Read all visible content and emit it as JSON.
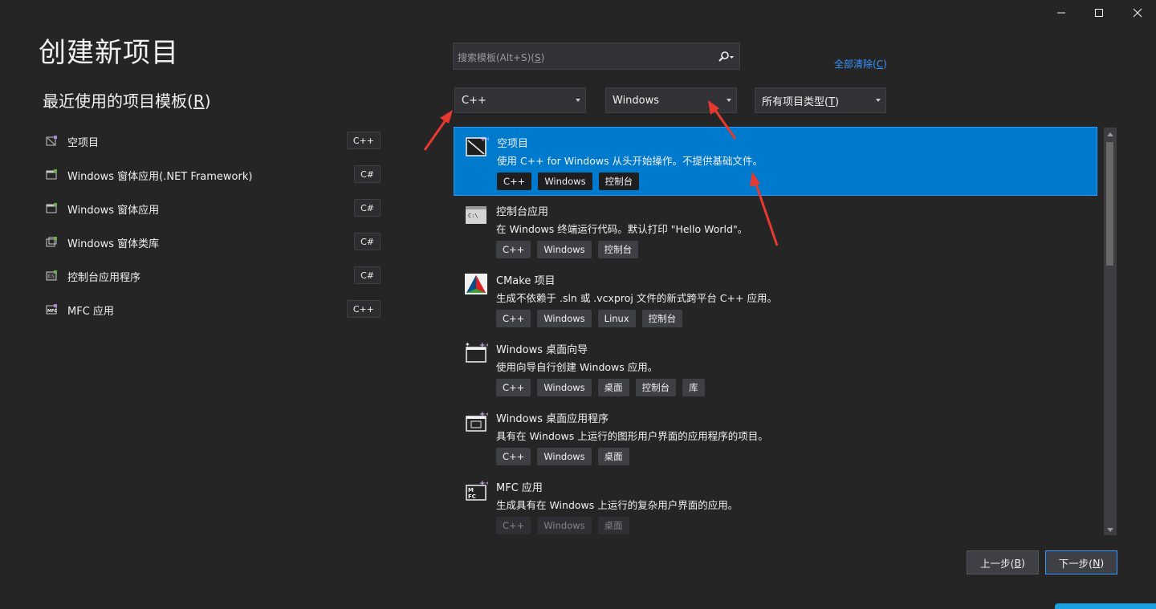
{
  "window": {
    "minimize_icon": "minimize-icon",
    "maximize_icon": "maximize-icon",
    "close_icon": "close-icon"
  },
  "page": {
    "title": "创建新项目"
  },
  "recent": {
    "heading_prefix": "最近使用的项目模板(",
    "heading_key": "R",
    "heading_suffix": ")",
    "items": [
      {
        "label": "空项目",
        "lang": "C++",
        "icon": "empty-project-icon"
      },
      {
        "label": "Windows 窗体应用(.NET Framework)",
        "lang": "C#",
        "icon": "windows-forms-icon"
      },
      {
        "label": "Windows 窗体应用",
        "lang": "C#",
        "icon": "windows-forms-icon"
      },
      {
        "label": "Windows 窗体类库",
        "lang": "C#",
        "icon": "class-library-icon"
      },
      {
        "label": "控制台应用程序",
        "lang": "C#",
        "icon": "console-app-icon"
      },
      {
        "label": "MFC 应用",
        "lang": "C++",
        "icon": "mfc-app-icon"
      }
    ]
  },
  "search": {
    "placeholder_prefix": "搜索模板(Alt+S)(",
    "placeholder_key": "S",
    "placeholder_suffix": ")",
    "icon": "search-icon"
  },
  "clear_all": {
    "prefix": "全部清除(",
    "key": "C",
    "suffix": ")"
  },
  "filters": {
    "language": "C++",
    "platform": "Windows",
    "type_prefix": "所有项目类型(",
    "type_key": "T",
    "type_suffix": ")"
  },
  "templates": [
    {
      "name": "空项目",
      "desc": "使用 C++ for Windows 从头开始操作。不提供基础文件。",
      "tags": [
        "C++",
        "Windows",
        "控制台"
      ],
      "selected": true,
      "icon": "empty-project-icon"
    },
    {
      "name": "控制台应用",
      "desc": "在 Windows 终端运行代码。默认打印 \"Hello World\"。",
      "tags": [
        "C++",
        "Windows",
        "控制台"
      ],
      "icon": "console-app-icon"
    },
    {
      "name": "CMake 项目",
      "desc": "生成不依赖于 .sln 或 .vcxproj 文件的新式跨平台 C++ 应用。",
      "tags": [
        "C++",
        "Windows",
        "Linux",
        "控制台"
      ],
      "icon": "cmake-icon"
    },
    {
      "name": "Windows 桌面向导",
      "desc": "使用向导自行创建 Windows 应用。",
      "tags": [
        "C++",
        "Windows",
        "桌面",
        "控制台",
        "库"
      ],
      "icon": "desktop-wizard-icon"
    },
    {
      "name": "Windows 桌面应用程序",
      "desc": "具有在 Windows 上运行的图形用户界面的应用程序的项目。",
      "tags": [
        "C++",
        "Windows",
        "桌面"
      ],
      "icon": "desktop-app-icon"
    },
    {
      "name": "MFC 应用",
      "desc": "生成具有在 Windows 上运行的复杂用户界面的应用。",
      "tags": [
        "C++",
        "Windows",
        "桌面"
      ],
      "icon": "mfc-app-icon"
    }
  ],
  "buttons": {
    "back_prefix": "上一步(",
    "back_key": "B",
    "back_suffix": ")",
    "next_prefix": "下一步(",
    "next_key": "N",
    "next_suffix": ")"
  },
  "colors": {
    "background": "#252526",
    "selection": "#007acc",
    "link": "#3794ff",
    "annotation_arrow": "#e8392f"
  }
}
